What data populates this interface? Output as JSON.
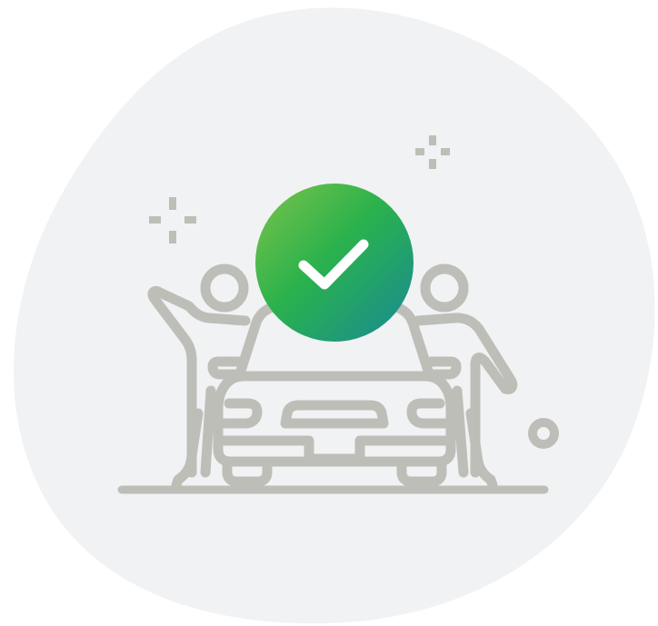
{
  "illustration": {
    "subject": "car-purchase-success",
    "icons": [
      "blob-background",
      "sparkle-icon",
      "person-icon",
      "car-icon",
      "check-badge-icon",
      "ring-icon",
      "ground-line"
    ],
    "colors": {
      "background": "#ffffff",
      "blob": "#f1f2f4",
      "line_art": "#bebeb8",
      "badge_gradient_start": "#7dc34a",
      "badge_gradient_mid": "#2bb24c",
      "badge_gradient_end": "#168a96",
      "check_mark": "#ffffff"
    }
  }
}
